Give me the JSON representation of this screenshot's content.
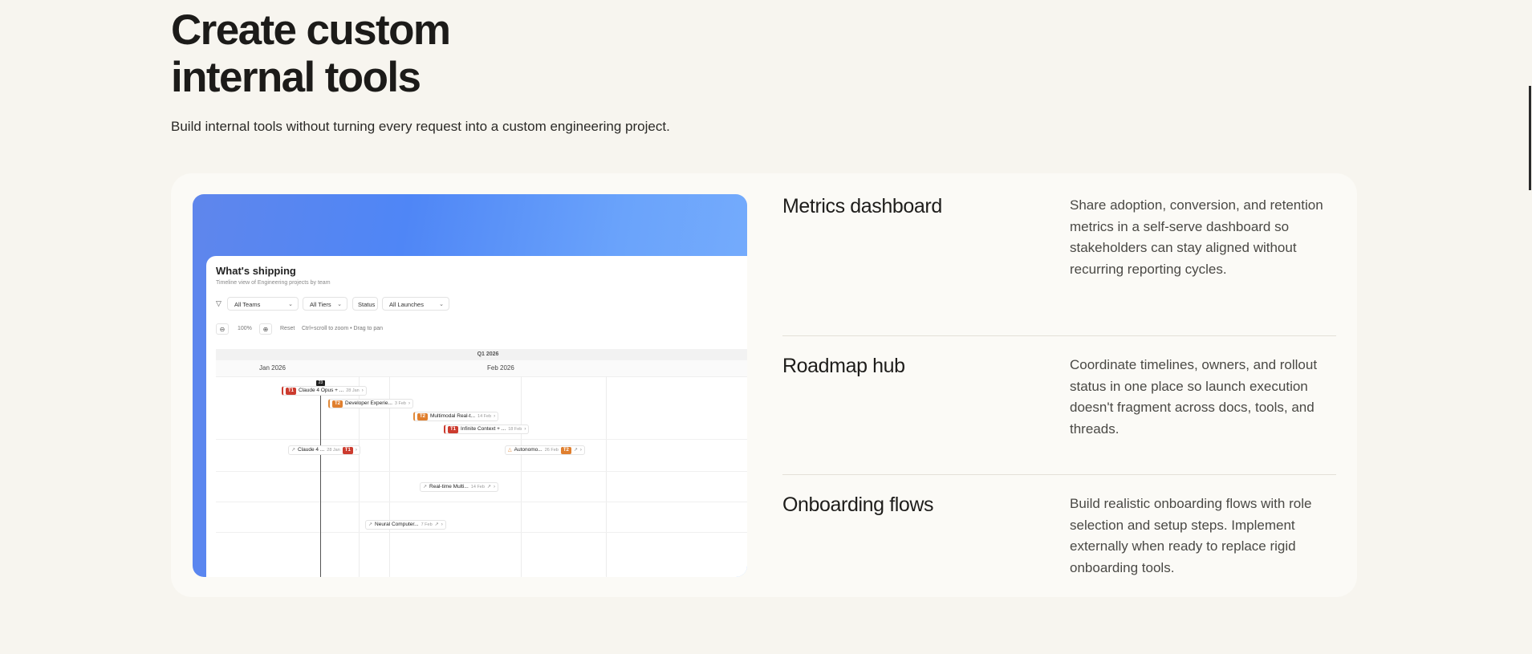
{
  "hero": {
    "title_line1": "Create custom",
    "title_line2": "internal tools",
    "subtitle": "Build internal tools without turning every request into a custom engineering project."
  },
  "preview": {
    "title": "What's shipping",
    "subtitle": "Timeline view of Engineering projects by team",
    "filters": {
      "teams": "All Teams",
      "tiers": "All Tiers",
      "status": "Status",
      "launches": "All Launches"
    },
    "zoom": {
      "level": "100%",
      "reset": "Reset",
      "hint": "Ctrl+scroll to zoom • Drag to pan"
    },
    "timeline": {
      "quarter": "Q1 2026",
      "months": [
        "Jan 2026",
        "Feb 2026"
      ],
      "today_badge": "23",
      "bars": [
        {
          "label": "Claude 4 Opus + ...",
          "date": "28 Jan",
          "tier": "T1",
          "tier_color": "#cc3b2e"
        },
        {
          "label": "Developer Experie...",
          "date": "3 Feb",
          "tier": "T2",
          "tier_color": "#e07f2e"
        },
        {
          "label": "Multimodal Real-t...",
          "date": "14 Feb",
          "tier": "T2",
          "tier_color": "#e07f2e"
        },
        {
          "label": "Infinite Context + ...",
          "date": "18 Feb",
          "tier": "T1",
          "tier_color": "#cc3b2e"
        },
        {
          "label": "Claude 4 ...",
          "date": "28 Jan",
          "tier": "T1",
          "tier_color": "#cc3b2e"
        },
        {
          "label": "Autonomo...",
          "date": "26 Feb",
          "tier": "T2",
          "tier_color": "#e07f2e"
        },
        {
          "label": "Real-time Multi...",
          "date": "14 Feb",
          "tier": "",
          "tier_color": ""
        },
        {
          "label": "Neural Computer...",
          "date": "7 Feb",
          "tier": "",
          "tier_color": ""
        }
      ]
    }
  },
  "features": [
    {
      "title": "Metrics dashboard",
      "description": "Share adoption, conversion, and retention metrics in a self-serve dashboard so stakeholders can stay aligned without recurring reporting cycles."
    },
    {
      "title": "Roadmap hub",
      "description": "Coordinate timelines, owners, and rollout status in one place so launch execution doesn't fragment across docs, tools, and threads."
    },
    {
      "title": "Onboarding flows",
      "description": "Build realistic onboarding flows with role selection and setup steps. Implement externally when ready to replace rigid onboarding tools."
    }
  ],
  "colors": {
    "page_background": "#f7f5ef",
    "card_background": "#fbfaf6",
    "gradient_start": "#5f86ec",
    "gradient_end": "#78aefc",
    "tier1": "#cc3b2e",
    "tier2": "#e07f2e"
  },
  "icons": [
    "filter-icon",
    "chevron-down-icon",
    "zoom-out-icon",
    "zoom-in-icon",
    "external-link-icon",
    "trend-icon",
    "warning-icon"
  ]
}
